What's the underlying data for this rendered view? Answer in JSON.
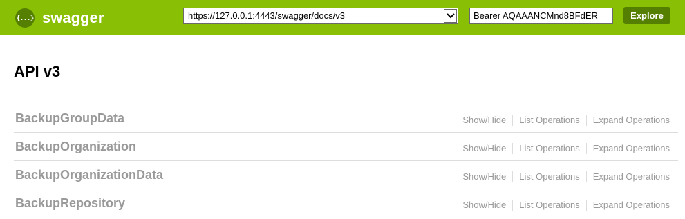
{
  "header": {
    "logo_glyph": "{...}",
    "logo_text": "swagger",
    "url_value": "https://127.0.0.1:4443/swagger/docs/v3",
    "token_value": "Bearer AQAAANCMnd8BFdER",
    "explore_label": "Explore",
    "brand_color": "#89bf04",
    "button_color": "#547f00"
  },
  "page": {
    "title": "API v3"
  },
  "resources": [
    {
      "name": "BackupGroupData",
      "show_hide": "Show/Hide",
      "list_ops": "List Operations",
      "expand_ops": "Expand Operations"
    },
    {
      "name": "BackupOrganization",
      "show_hide": "Show/Hide",
      "list_ops": "List Operations",
      "expand_ops": "Expand Operations"
    },
    {
      "name": "BackupOrganizationData",
      "show_hide": "Show/Hide",
      "list_ops": "List Operations",
      "expand_ops": "Expand Operations"
    },
    {
      "name": "BackupRepository",
      "show_hide": "Show/Hide",
      "list_ops": "List Operations",
      "expand_ops": "Expand Operations"
    }
  ]
}
